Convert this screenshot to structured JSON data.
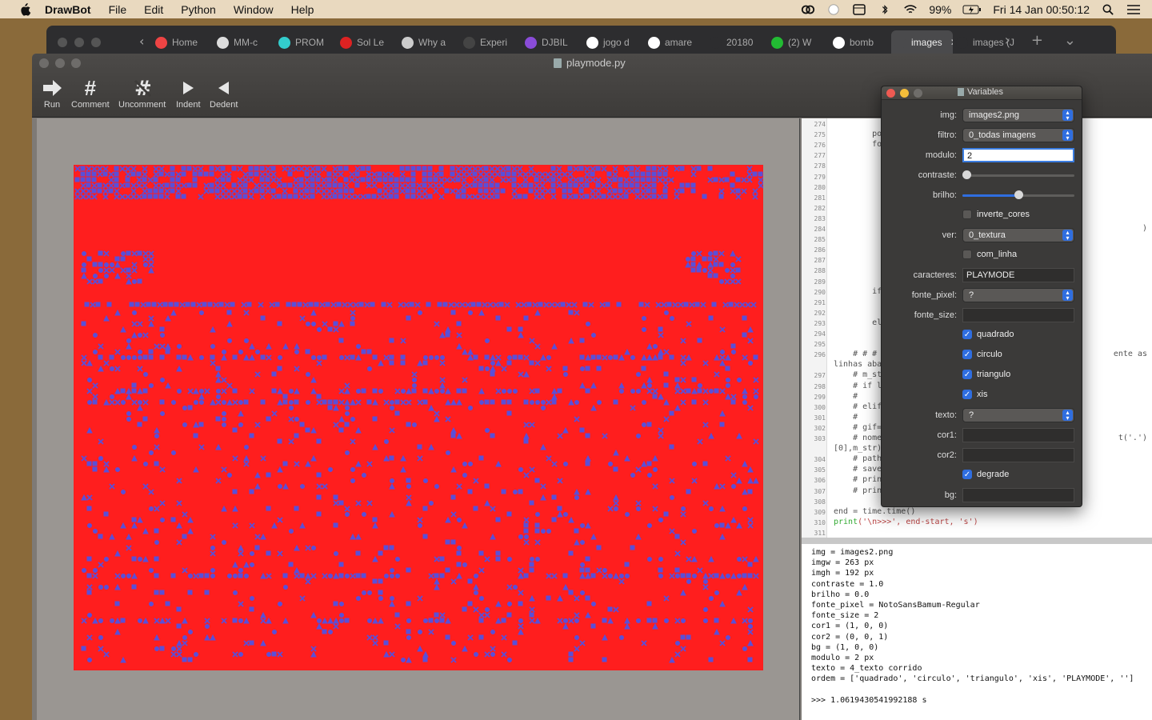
{
  "menubar": {
    "items": [
      "DrawBot",
      "File",
      "Edit",
      "Python",
      "Window",
      "Help"
    ],
    "battery": "99%",
    "clock": "Fri 14 Jan  00:50:12"
  },
  "browser": {
    "tabs": [
      {
        "label": "Home",
        "color": "#e44"
      },
      {
        "label": "MM-c",
        "color": "#ddd"
      },
      {
        "label": "PROM",
        "color": "#3cc"
      },
      {
        "label": "Sol Le",
        "color": "#d22"
      },
      {
        "label": "Why a",
        "color": "#ccc"
      },
      {
        "label": "Experi",
        "color": "#444"
      },
      {
        "label": "DJBIL",
        "color": "#8a4cd8"
      },
      {
        "label": "jogo d",
        "color": "#fff"
      },
      {
        "label": "amare",
        "color": "#fff"
      },
      {
        "label": "20180",
        "color": "#2d2d2f"
      },
      {
        "label": "(2) W",
        "color": "#2b3"
      },
      {
        "label": "bomb",
        "color": "#fff"
      },
      {
        "label": "images",
        "color": "#4a4a4c",
        "active": true
      },
      {
        "label": "images (J",
        "color": "#2d2d2f"
      }
    ]
  },
  "window": {
    "title": "playmode.py",
    "toolbar": [
      "Run",
      "Comment",
      "Uncomment",
      "Indent",
      "Dedent"
    ]
  },
  "code": {
    "numbers": [
      "274",
      "275",
      "276",
      "277",
      "278",
      "279",
      "280",
      "281",
      "282",
      "283",
      "284",
      "285",
      "286",
      "287",
      "288",
      "289",
      "290",
      "291",
      "292",
      "293",
      "294",
      "295",
      "296",
      "",
      "297",
      "298",
      "299",
      "300",
      "301",
      "302",
      "303",
      "",
      "304",
      "305",
      "306",
      "307",
      "308",
      "309",
      "310",
      "311"
    ],
    "fragments": [
      {
        "line": 1,
        "text": "        po"
      },
      {
        "line": 2,
        "text": "        fo"
      },
      {
        "line": 16,
        "text": "        if"
      },
      {
        "line": 19,
        "text": "        el"
      },
      {
        "line": 22,
        "text": "    # # #"
      },
      {
        "line": 23,
        "text": "linhas aba"
      },
      {
        "line": 24,
        "text": "    # m_st"
      },
      {
        "line": 25,
        "text": "    # if l"
      },
      {
        "line": 26,
        "text": "    #"
      },
      {
        "line": 27,
        "text": "    # elif"
      },
      {
        "line": 28,
        "text": "    #"
      },
      {
        "line": 29,
        "text": "    # gif="
      },
      {
        "line": 30,
        "text": "    # nome"
      },
      {
        "line": 31,
        "text": "[0],m_str)"
      },
      {
        "line": 32,
        "text": "    # path"
      },
      {
        "line": 33,
        "text": "    # save"
      },
      {
        "line": 34,
        "text": "    # prin"
      },
      {
        "line": 35,
        "text": "    # prin"
      }
    ],
    "right_bits": [
      {
        "line": 10,
        "text": ")"
      },
      {
        "line": 22,
        "text": "ente as"
      },
      {
        "line": 30,
        "text": "t('.')"
      }
    ],
    "end_line_a": "end = time.time()",
    "end_line_b_fn": "print",
    "end_line_b_str": "('\\n>>>', end-start, 's')"
  },
  "output": {
    "lines": [
      "img = images2.png",
      "imgw = 263 px",
      "imgh = 192 px",
      "contraste = 1.0",
      "brilho = 0.0",
      "fonte_pixel = NotoSansBamum-Regular",
      "fonte_size = 2",
      "cor1 = (1, 0, 0)",
      "cor2 = (0, 0, 1)",
      "bg = (1, 0, 0)",
      "modulo = 2 px",
      "texto = 4_texto corrido",
      "ordem = ['quadrado', 'circulo', 'triangulo', 'xis', 'PLAYMODE', '']",
      "",
      ">>> 1.0619430541992188 s"
    ]
  },
  "vars": {
    "title": "Variables",
    "rows": [
      {
        "label": "img:",
        "kind": "popup",
        "value": "images2.png"
      },
      {
        "label": "filtro:",
        "kind": "popup",
        "value": "0_todas imagens"
      },
      {
        "label": "modulo:",
        "kind": "field-focus",
        "value": "2"
      },
      {
        "label": "contraste:",
        "kind": "slider",
        "value": 0.0
      },
      {
        "label": "brilho:",
        "kind": "slider",
        "value": 0.5
      },
      {
        "label": "",
        "kind": "check",
        "value": "inverte_cores",
        "checked": false
      },
      {
        "label": "ver:",
        "kind": "popup",
        "value": "0_textura"
      },
      {
        "label": "",
        "kind": "check",
        "value": "com_linha",
        "checked": false
      },
      {
        "label": "caracteres:",
        "kind": "field",
        "value": "PLAYMODE"
      },
      {
        "label": "fonte_pixel:",
        "kind": "popup",
        "value": "?"
      },
      {
        "label": "fonte_size:",
        "kind": "field",
        "value": ""
      },
      {
        "label": "",
        "kind": "check",
        "value": "quadrado",
        "checked": true
      },
      {
        "label": "",
        "kind": "check",
        "value": "circulo",
        "checked": true
      },
      {
        "label": "",
        "kind": "check",
        "value": "triangulo",
        "checked": true
      },
      {
        "label": "",
        "kind": "check",
        "value": "xis",
        "checked": true
      },
      {
        "label": "texto:",
        "kind": "popup",
        "value": "?"
      },
      {
        "label": "cor1:",
        "kind": "field",
        "value": ""
      },
      {
        "label": "cor2:",
        "kind": "field",
        "value": ""
      },
      {
        "label": "",
        "kind": "check",
        "value": "degrade",
        "checked": true
      },
      {
        "label": "bg:",
        "kind": "field",
        "value": ""
      }
    ]
  },
  "colors": {
    "canvas_bg": "#ff1e1e",
    "glyph": "#5a4fd8",
    "accent": "#2f6ee0"
  },
  "art": {
    "chars": "PLAYMODE"
  }
}
